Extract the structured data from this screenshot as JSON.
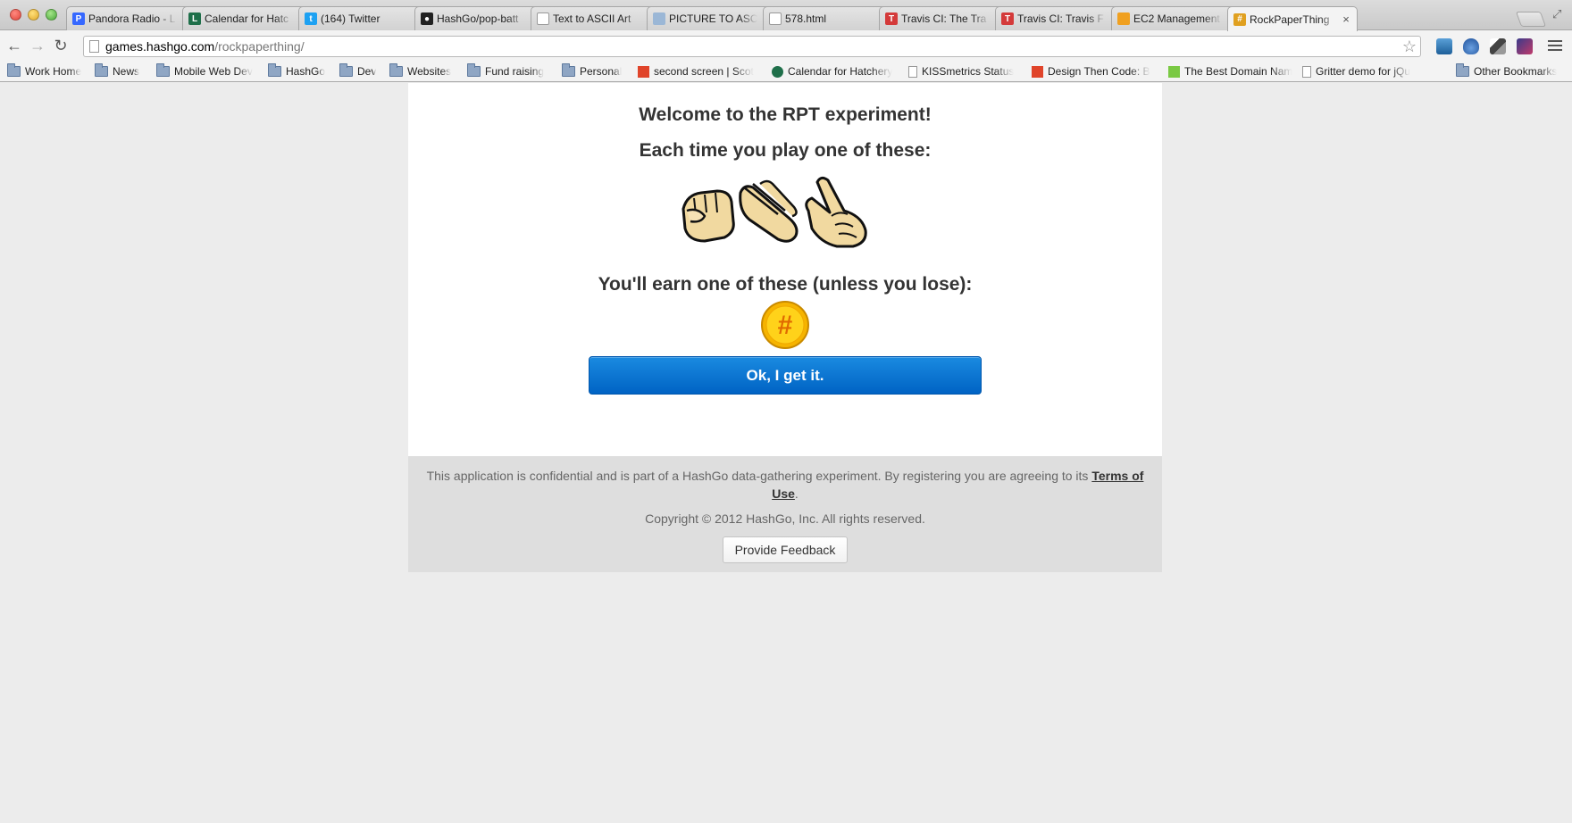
{
  "browser": {
    "tabs": [
      {
        "title": "Pandora Radio - L",
        "favicon": "pandora-icon",
        "color": "#3668ff",
        "glyph": "P"
      },
      {
        "title": "Calendar for Hatc",
        "favicon": "calendar-icon",
        "color": "#1f6f4a",
        "glyph": "L"
      },
      {
        "title": "(164) Twitter",
        "favicon": "twitter-icon",
        "color": "#1da1f2",
        "glyph": "t"
      },
      {
        "title": "HashGo/pop-batt",
        "favicon": "github-icon",
        "color": "#222222",
        "glyph": "●"
      },
      {
        "title": "Text to ASCII Art",
        "favicon": "page-icon",
        "color": "#ffffff",
        "glyph": ""
      },
      {
        "title": "PICTURE TO ASCI",
        "favicon": "picture-icon",
        "color": "#9bb7d6",
        "glyph": ""
      },
      {
        "title": "578.html",
        "favicon": "page-icon",
        "color": "#ffffff",
        "glyph": ""
      },
      {
        "title": "Travis CI: The Tra",
        "favicon": "travis-icon",
        "color": "#d43a3a",
        "glyph": "T"
      },
      {
        "title": "Travis CI: Travis F",
        "favicon": "travis-icon",
        "color": "#d43a3a",
        "glyph": "T"
      },
      {
        "title": "EC2 Management",
        "favicon": "aws-icon",
        "color": "#f0a020",
        "glyph": ""
      },
      {
        "title": "RockPaperThing",
        "favicon": "hashgo-icon",
        "color": "#e0a020",
        "glyph": "#"
      }
    ],
    "url_host": "games.hashgo.com",
    "url_path": "/rockpaperthing/",
    "bookmarks": [
      {
        "label": "Work Home",
        "icon": "folder-icon"
      },
      {
        "label": "News",
        "icon": "folder-icon"
      },
      {
        "label": "Mobile Web Dev",
        "icon": "folder-icon"
      },
      {
        "label": "HashGo",
        "icon": "folder-icon"
      },
      {
        "label": "Dev",
        "icon": "folder-icon"
      },
      {
        "label": "Websites",
        "icon": "folder-icon"
      },
      {
        "label": "Fund raising",
        "icon": "folder-icon"
      },
      {
        "label": "Personal",
        "icon": "folder-icon"
      },
      {
        "label": "second screen | Scot",
        "icon": "site-icon"
      },
      {
        "label": "Calendar for Hatchery",
        "icon": "calendar-icon"
      },
      {
        "label": "KISSmetrics Status",
        "icon": "page-icon"
      },
      {
        "label": "Design Then Code: B",
        "icon": "site-icon"
      },
      {
        "label": "The Best Domain Nam",
        "icon": "site-icon"
      },
      {
        "label": "Gritter demo for jQu",
        "icon": "page-icon"
      },
      {
        "label": "Other Bookmarks",
        "icon": "folder-icon"
      }
    ]
  },
  "page": {
    "welcome": "Welcome to the RPT experiment!",
    "each_time": "Each time you play one of these:",
    "earn": "You'll earn one of these (unless you lose):",
    "ok_button": "Ok, I get it.",
    "legal_text": "This application is confidential and is part of a HashGo data-gathering experiment. By registering you are agreeing to its ",
    "terms_link": "Terms of Use",
    "legal_end": ".",
    "copyright": "Copyright © 2012 HashGo, Inc. All rights reserved.",
    "feedback_button": "Provide Feedback"
  },
  "colors": {
    "accent": "#0a74d6",
    "background": "#ececec",
    "footer": "#dedede"
  }
}
